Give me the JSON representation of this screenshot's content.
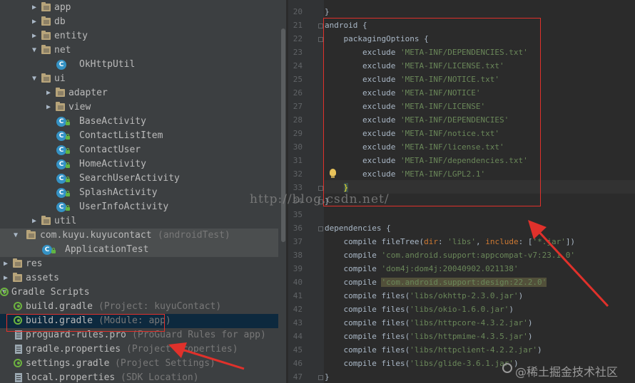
{
  "tree": {
    "rows": [
      {
        "label": "app",
        "kind": "folder",
        "arrow": "right"
      },
      {
        "label": "db",
        "kind": "folder",
        "arrow": "right"
      },
      {
        "label": "entity",
        "kind": "folder",
        "arrow": "right"
      },
      {
        "label": "net",
        "kind": "folder",
        "arrow": "down"
      },
      {
        "label": "OkHttpUtil",
        "kind": "class"
      },
      {
        "label": "ui",
        "kind": "folder",
        "arrow": "down"
      },
      {
        "label": "adapter",
        "kind": "folder",
        "arrow": "right"
      },
      {
        "label": "view",
        "kind": "folder",
        "arrow": "right"
      },
      {
        "label": "BaseActivity",
        "kind": "class-lock"
      },
      {
        "label": "ContactListItem",
        "kind": "class-lock"
      },
      {
        "label": "ContactUser",
        "kind": "class-lock"
      },
      {
        "label": "HomeActivity",
        "kind": "class-lock"
      },
      {
        "label": "SearchUserActivity",
        "kind": "class-lock"
      },
      {
        "label": "SplashActivity",
        "kind": "class-lock"
      },
      {
        "label": "UserInfoActivity",
        "kind": "class-lock"
      },
      {
        "label": "util",
        "kind": "folder",
        "arrow": "right"
      },
      {
        "label": "com.kuyu.kuyucontact",
        "hint": "(androidTest)",
        "kind": "folder",
        "arrow": "down"
      },
      {
        "label": "ApplicationTest",
        "kind": "class-lock"
      },
      {
        "label": "res",
        "kind": "folder",
        "arrow": "right"
      },
      {
        "label": "assets",
        "kind": "folder",
        "arrow": "right"
      },
      {
        "label": "Gradle Scripts",
        "kind": "gradle",
        "arrow": "down"
      },
      {
        "label": "build.gradle",
        "hint": "(Project: kuyuContact)",
        "kind": "gradle"
      },
      {
        "label": "build.gradle",
        "hint": "(Module: app)",
        "kind": "gradle"
      },
      {
        "label": "proguard-rules.pro",
        "hint": "(ProGuard Rules for app)",
        "kind": "prop"
      },
      {
        "label": "gradle.properties",
        "hint": "(Project Properties)",
        "kind": "prop"
      },
      {
        "label": "settings.gradle",
        "hint": "(Project Settings)",
        "kind": "gradle"
      },
      {
        "label": "local.properties",
        "hint": "(SDK Location)",
        "kind": "prop"
      }
    ]
  },
  "editor": {
    "lines": [
      {
        "n": "20",
        "code": [
          {
            "t": "}",
            "c": "kw"
          }
        ]
      },
      {
        "n": "21",
        "code": [
          {
            "t": "android {",
            "c": "kw"
          }
        ]
      },
      {
        "n": "22",
        "code": [
          {
            "t": "    packagingOptions ",
            "c": "kw"
          },
          {
            "t": "{",
            "c": "brace"
          }
        ]
      },
      {
        "n": "23",
        "code": [
          {
            "t": "        exclude ",
            "c": "kw"
          },
          {
            "t": "'META-INF/DEPENDENCIES.txt'",
            "c": "str"
          }
        ]
      },
      {
        "n": "24",
        "code": [
          {
            "t": "        exclude ",
            "c": "kw"
          },
          {
            "t": "'META-INF/LICENSE.txt'",
            "c": "str"
          }
        ]
      },
      {
        "n": "25",
        "code": [
          {
            "t": "        exclude ",
            "c": "kw"
          },
          {
            "t": "'META-INF/NOTICE.txt'",
            "c": "str"
          }
        ]
      },
      {
        "n": "26",
        "code": [
          {
            "t": "        exclude ",
            "c": "kw"
          },
          {
            "t": "'META-INF/NOTICE'",
            "c": "str"
          }
        ]
      },
      {
        "n": "27",
        "code": [
          {
            "t": "        exclude ",
            "c": "kw"
          },
          {
            "t": "'META-INF/LICENSE'",
            "c": "str"
          }
        ]
      },
      {
        "n": "28",
        "code": [
          {
            "t": "        exclude ",
            "c": "kw"
          },
          {
            "t": "'META-INF/DEPENDENCIES'",
            "c": "str"
          }
        ]
      },
      {
        "n": "29",
        "code": [
          {
            "t": "        exclude ",
            "c": "kw"
          },
          {
            "t": "'META-INF/notice.txt'",
            "c": "str"
          }
        ]
      },
      {
        "n": "30",
        "code": [
          {
            "t": "        exclude ",
            "c": "kw"
          },
          {
            "t": "'META-INF/license.txt'",
            "c": "str"
          }
        ]
      },
      {
        "n": "31",
        "code": [
          {
            "t": "        exclude ",
            "c": "kw"
          },
          {
            "t": "'META-INF/dependencies.txt'",
            "c": "str"
          }
        ]
      },
      {
        "n": "32",
        "code": [
          {
            "t": "        exclude ",
            "c": "kw"
          },
          {
            "t": "'META-INF/LGPL2.1'",
            "c": "str"
          }
        ]
      },
      {
        "n": "33",
        "code": [
          {
            "t": "    ",
            "c": "kw"
          },
          {
            "t": "}",
            "c": "brace"
          }
        ]
      },
      {
        "n": "34",
        "code": [
          {
            "t": "}",
            "c": "kw"
          }
        ]
      },
      {
        "n": "35",
        "code": []
      },
      {
        "n": "36",
        "code": [
          {
            "t": "dependencies {",
            "c": "kw"
          }
        ]
      },
      {
        "n": "37",
        "code": [
          {
            "t": "    compile ",
            "c": "kw"
          },
          {
            "t": "fileTree",
            "c": "kw"
          },
          {
            "t": "(",
            "c": "kw"
          },
          {
            "t": "dir",
            "c": "fn"
          },
          {
            "t": ": ",
            "c": "kw"
          },
          {
            "t": "'libs'",
            "c": "str"
          },
          {
            "t": ", ",
            "c": "kw"
          },
          {
            "t": "include",
            "c": "fn"
          },
          {
            "t": ": [",
            "c": "kw"
          },
          {
            "t": "'*.jar'",
            "c": "str"
          },
          {
            "t": "])",
            "c": "kw"
          }
        ]
      },
      {
        "n": "38",
        "code": [
          {
            "t": "    compile ",
            "c": "kw"
          },
          {
            "t": "'com.android.support:appcompat-v7:23.1.0'",
            "c": "str"
          }
        ]
      },
      {
        "n": "39",
        "code": [
          {
            "t": "    compile ",
            "c": "kw"
          },
          {
            "t": "'dom4j:dom4j:20040902.021138'",
            "c": "str"
          }
        ]
      },
      {
        "n": "40",
        "code": [
          {
            "t": "    compile ",
            "c": "kw"
          },
          {
            "t": "'com.android.support:design:22.2.0'",
            "c": "strhl"
          }
        ]
      },
      {
        "n": "41",
        "code": [
          {
            "t": "    compile ",
            "c": "kw"
          },
          {
            "t": "files",
            "c": "kw"
          },
          {
            "t": "(",
            "c": "kw"
          },
          {
            "t": "'libs/okhttp-2.3.0.jar'",
            "c": "str"
          },
          {
            "t": ")",
            "c": "kw"
          }
        ]
      },
      {
        "n": "42",
        "code": [
          {
            "t": "    compile ",
            "c": "kw"
          },
          {
            "t": "files",
            "c": "kw"
          },
          {
            "t": "(",
            "c": "kw"
          },
          {
            "t": "'libs/okio-1.6.0.jar'",
            "c": "str"
          },
          {
            "t": ")",
            "c": "kw"
          }
        ]
      },
      {
        "n": "43",
        "code": [
          {
            "t": "    compile ",
            "c": "kw"
          },
          {
            "t": "files",
            "c": "kw"
          },
          {
            "t": "(",
            "c": "kw"
          },
          {
            "t": "'libs/httpcore-4.3.2.jar'",
            "c": "str"
          },
          {
            "t": ")",
            "c": "kw"
          }
        ]
      },
      {
        "n": "44",
        "code": [
          {
            "t": "    compile ",
            "c": "kw"
          },
          {
            "t": "files",
            "c": "kw"
          },
          {
            "t": "(",
            "c": "kw"
          },
          {
            "t": "'libs/httpmime-4.3.5.jar'",
            "c": "str"
          },
          {
            "t": ")",
            "c": "kw"
          }
        ]
      },
      {
        "n": "45",
        "code": [
          {
            "t": "    compile ",
            "c": "kw"
          },
          {
            "t": "files",
            "c": "kw"
          },
          {
            "t": "(",
            "c": "kw"
          },
          {
            "t": "'libs/httpclient-4.2.2.jar'",
            "c": "str"
          },
          {
            "t": ")",
            "c": "kw"
          }
        ]
      },
      {
        "n": "46",
        "code": [
          {
            "t": "    compile ",
            "c": "kw"
          },
          {
            "t": "files",
            "c": "kw"
          },
          {
            "t": "(",
            "c": "kw"
          },
          {
            "t": "'libs/glide-3.6.1.jar'",
            "c": "str"
          },
          {
            "t": ")",
            "c": "kw"
          }
        ]
      },
      {
        "n": "47",
        "code": [
          {
            "t": "}",
            "c": "kw"
          }
        ]
      }
    ]
  },
  "overlay": {
    "watermark": "http://blog.csdn.net/",
    "brand": "@稀土掘金技术社区"
  },
  "colors": {
    "annotation": "#e0312b",
    "string": "#6a8759",
    "folder": "#b7a47a",
    "class": "#3592c4",
    "gradle": "#6db33f"
  }
}
